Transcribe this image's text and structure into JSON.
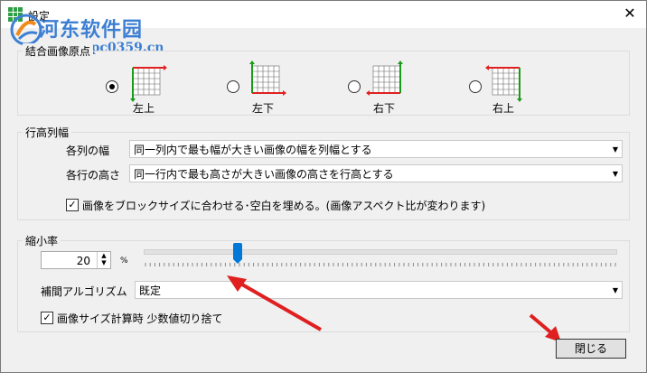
{
  "window": {
    "title": "設定"
  },
  "watermark": {
    "main": "河东软件园",
    "sub": "www.pc0359.cn"
  },
  "origin_group": {
    "title": "結合画像原点",
    "options": [
      {
        "label": "左上",
        "selected": true
      },
      {
        "label": "左下",
        "selected": false
      },
      {
        "label": "右下",
        "selected": false
      },
      {
        "label": "右上",
        "selected": false
      }
    ]
  },
  "row_col_group": {
    "title": "行高列幅",
    "col_width_label": "各列の幅",
    "col_width_value": "同一列内で最も幅が大きい画像の幅を列幅とする",
    "row_height_label": "各行の高さ",
    "row_height_value": "同一行内で最も高さが大きい画像の高さを行高とする",
    "fit_checkbox_label": "画像をブロックサイズに合わせる･空白を埋める。(画像アスペクト比が変わります)",
    "fit_checked": true
  },
  "scale_group": {
    "title": "縮小率",
    "value": "20",
    "unit": "%",
    "slider_value_percent": 20,
    "interp_label": "補間アルゴリズム",
    "interp_value": "既定",
    "truncate_checkbox_label": "画像サイズ計算時 少数値切り捨て",
    "truncate_checked": true
  },
  "buttons": {
    "close": "閉じる"
  },
  "colors": {
    "arrow_red": "#e02020",
    "axis_green": "#1a9a1a",
    "thumb_blue": "#0078d7"
  }
}
